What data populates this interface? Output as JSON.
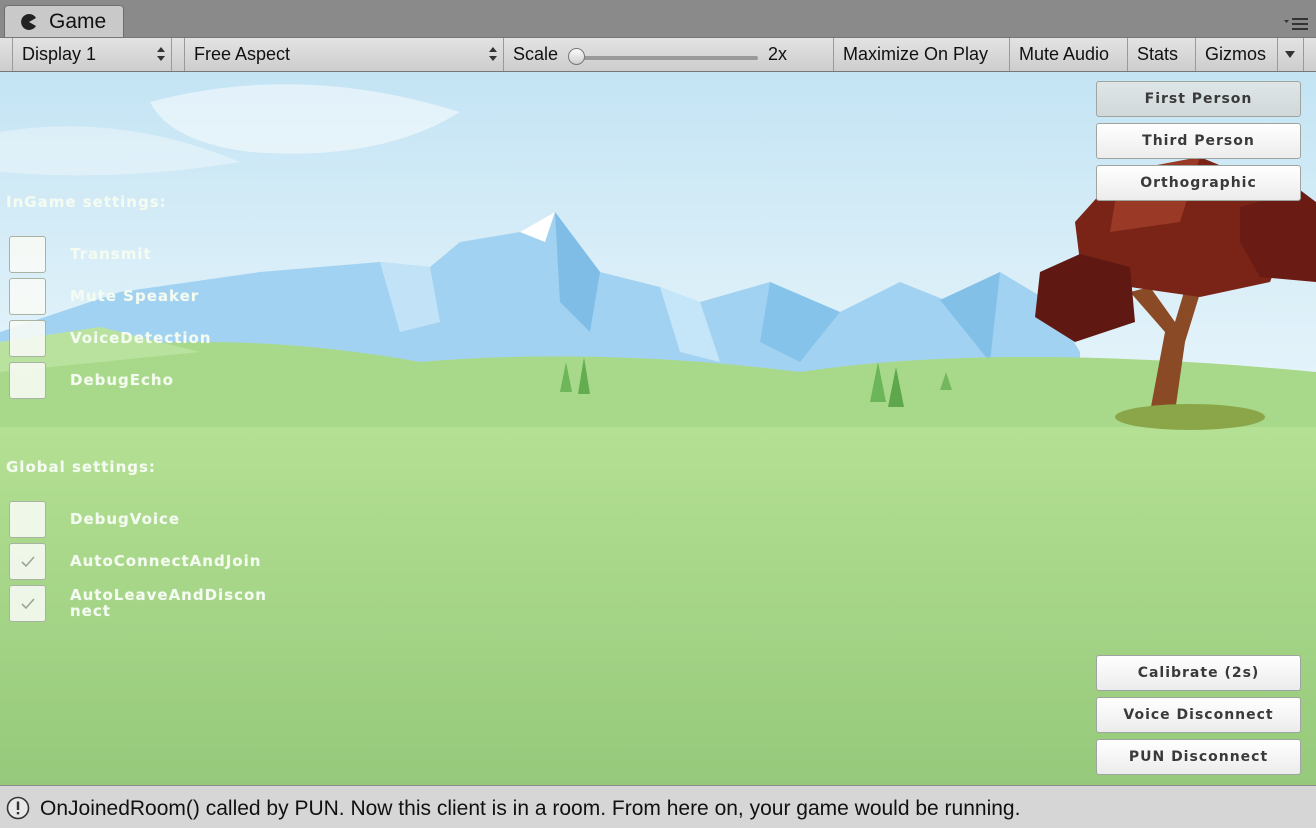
{
  "window": {
    "tab_title": "Game",
    "tab_icon": "pacman-game-icon",
    "menu_icon": "panel-menu-icon"
  },
  "toolbar": {
    "display_select": "Display 1",
    "aspect_select": "Free Aspect",
    "scale_label": "Scale",
    "scale_value": "2x",
    "scale_fraction": 0.0,
    "maximize_on_play": "Maximize On Play",
    "mute_audio": "Mute Audio",
    "stats": "Stats",
    "gizmos": "Gizmos"
  },
  "game_ui": {
    "ingame_heading": "InGame settings:",
    "ingame_toggles": [
      {
        "label": "Transmit",
        "checked": false
      },
      {
        "label": "Mute Speaker",
        "checked": false
      },
      {
        "label": "VoiceDetection",
        "checked": false
      },
      {
        "label": "DebugEcho",
        "checked": false
      }
    ],
    "global_heading": "Global settings:",
    "global_toggles": [
      {
        "label": "DebugVoice",
        "checked": false
      },
      {
        "label": "AutoConnectAndJoin",
        "checked": true
      },
      {
        "label": "AutoLeaveAndDiscon",
        "label_line2": "nect",
        "checked": true
      }
    ],
    "camera_buttons": [
      {
        "label": "First Person",
        "active": true
      },
      {
        "label": "Third Person",
        "active": false
      },
      {
        "label": "Orthographic",
        "active": false
      }
    ],
    "action_buttons": [
      {
        "label": "Calibrate (2s)"
      },
      {
        "label": "Voice Disconnect"
      },
      {
        "label": "PUN Disconnect"
      }
    ]
  },
  "status_bar": {
    "icon": "info-exclamation-icon",
    "message": "OnJoinedRoom() called by PUN. Now this client is in a room. From here on, your game would be running."
  },
  "colors": {
    "sky_top": "#c8e6f5",
    "grass": "#9ccf7d",
    "mountain": "#9fd0f0",
    "tree_foliage": "#7a2418"
  }
}
